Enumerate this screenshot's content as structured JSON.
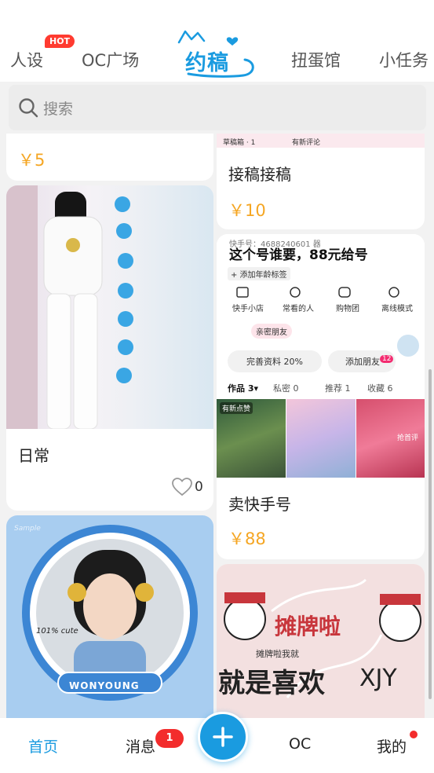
{
  "tabs": [
    {
      "label": "人设"
    },
    {
      "label": "OC广场"
    },
    {
      "label": "约稿"
    },
    {
      "label": "扭蛋馆"
    },
    {
      "label": "小任务"
    }
  ],
  "hot_badge": "HOT",
  "search": {
    "placeholder": "搜索"
  },
  "cards": {
    "top_left": {
      "price": "￥5"
    },
    "top_right": {
      "title": "接稿接稿",
      "price": "￥10",
      "img_text_1": "草稿箱 · 1",
      "img_text_2": "有新评论"
    },
    "daily": {
      "title": "日常",
      "likes": "0"
    },
    "kuaishou": {
      "title": "卖快手号",
      "price": "￥88",
      "banner": "这个号谁要，88元给号",
      "id_line": "快手号：4688240601 器",
      "add_age": "+ 添加年龄标签",
      "shortcuts": [
        "快手小店",
        "常看的人",
        "购物团",
        "离线模式"
      ],
      "close_friend": "亲密朋友",
      "complete_profile": "完善资料 20%",
      "add_friend": "添加朋友",
      "add_friend_count": "12",
      "works_tabs": [
        "作品 3▾",
        "私密 0",
        "推荐 1",
        "收藏 6"
      ],
      "new_like": "有新点赞",
      "review": "抢首评"
    },
    "avatar_card": {
      "cute": "101% cute",
      "name": "WONYOUNG",
      "watermark": "Sample"
    },
    "shop_card": {
      "line1": "摊牌啦",
      "line2": "摊牌啦我就",
      "line3": "就是喜欢",
      "line4": "XJY"
    }
  },
  "bottom_nav": {
    "home": "首页",
    "messages": "消息",
    "messages_badge": "1",
    "oc": "OC",
    "mine": "我的"
  },
  "colors": {
    "accent": "#1a9be0",
    "price": "#f5a623",
    "badge": "#f32c2c"
  }
}
